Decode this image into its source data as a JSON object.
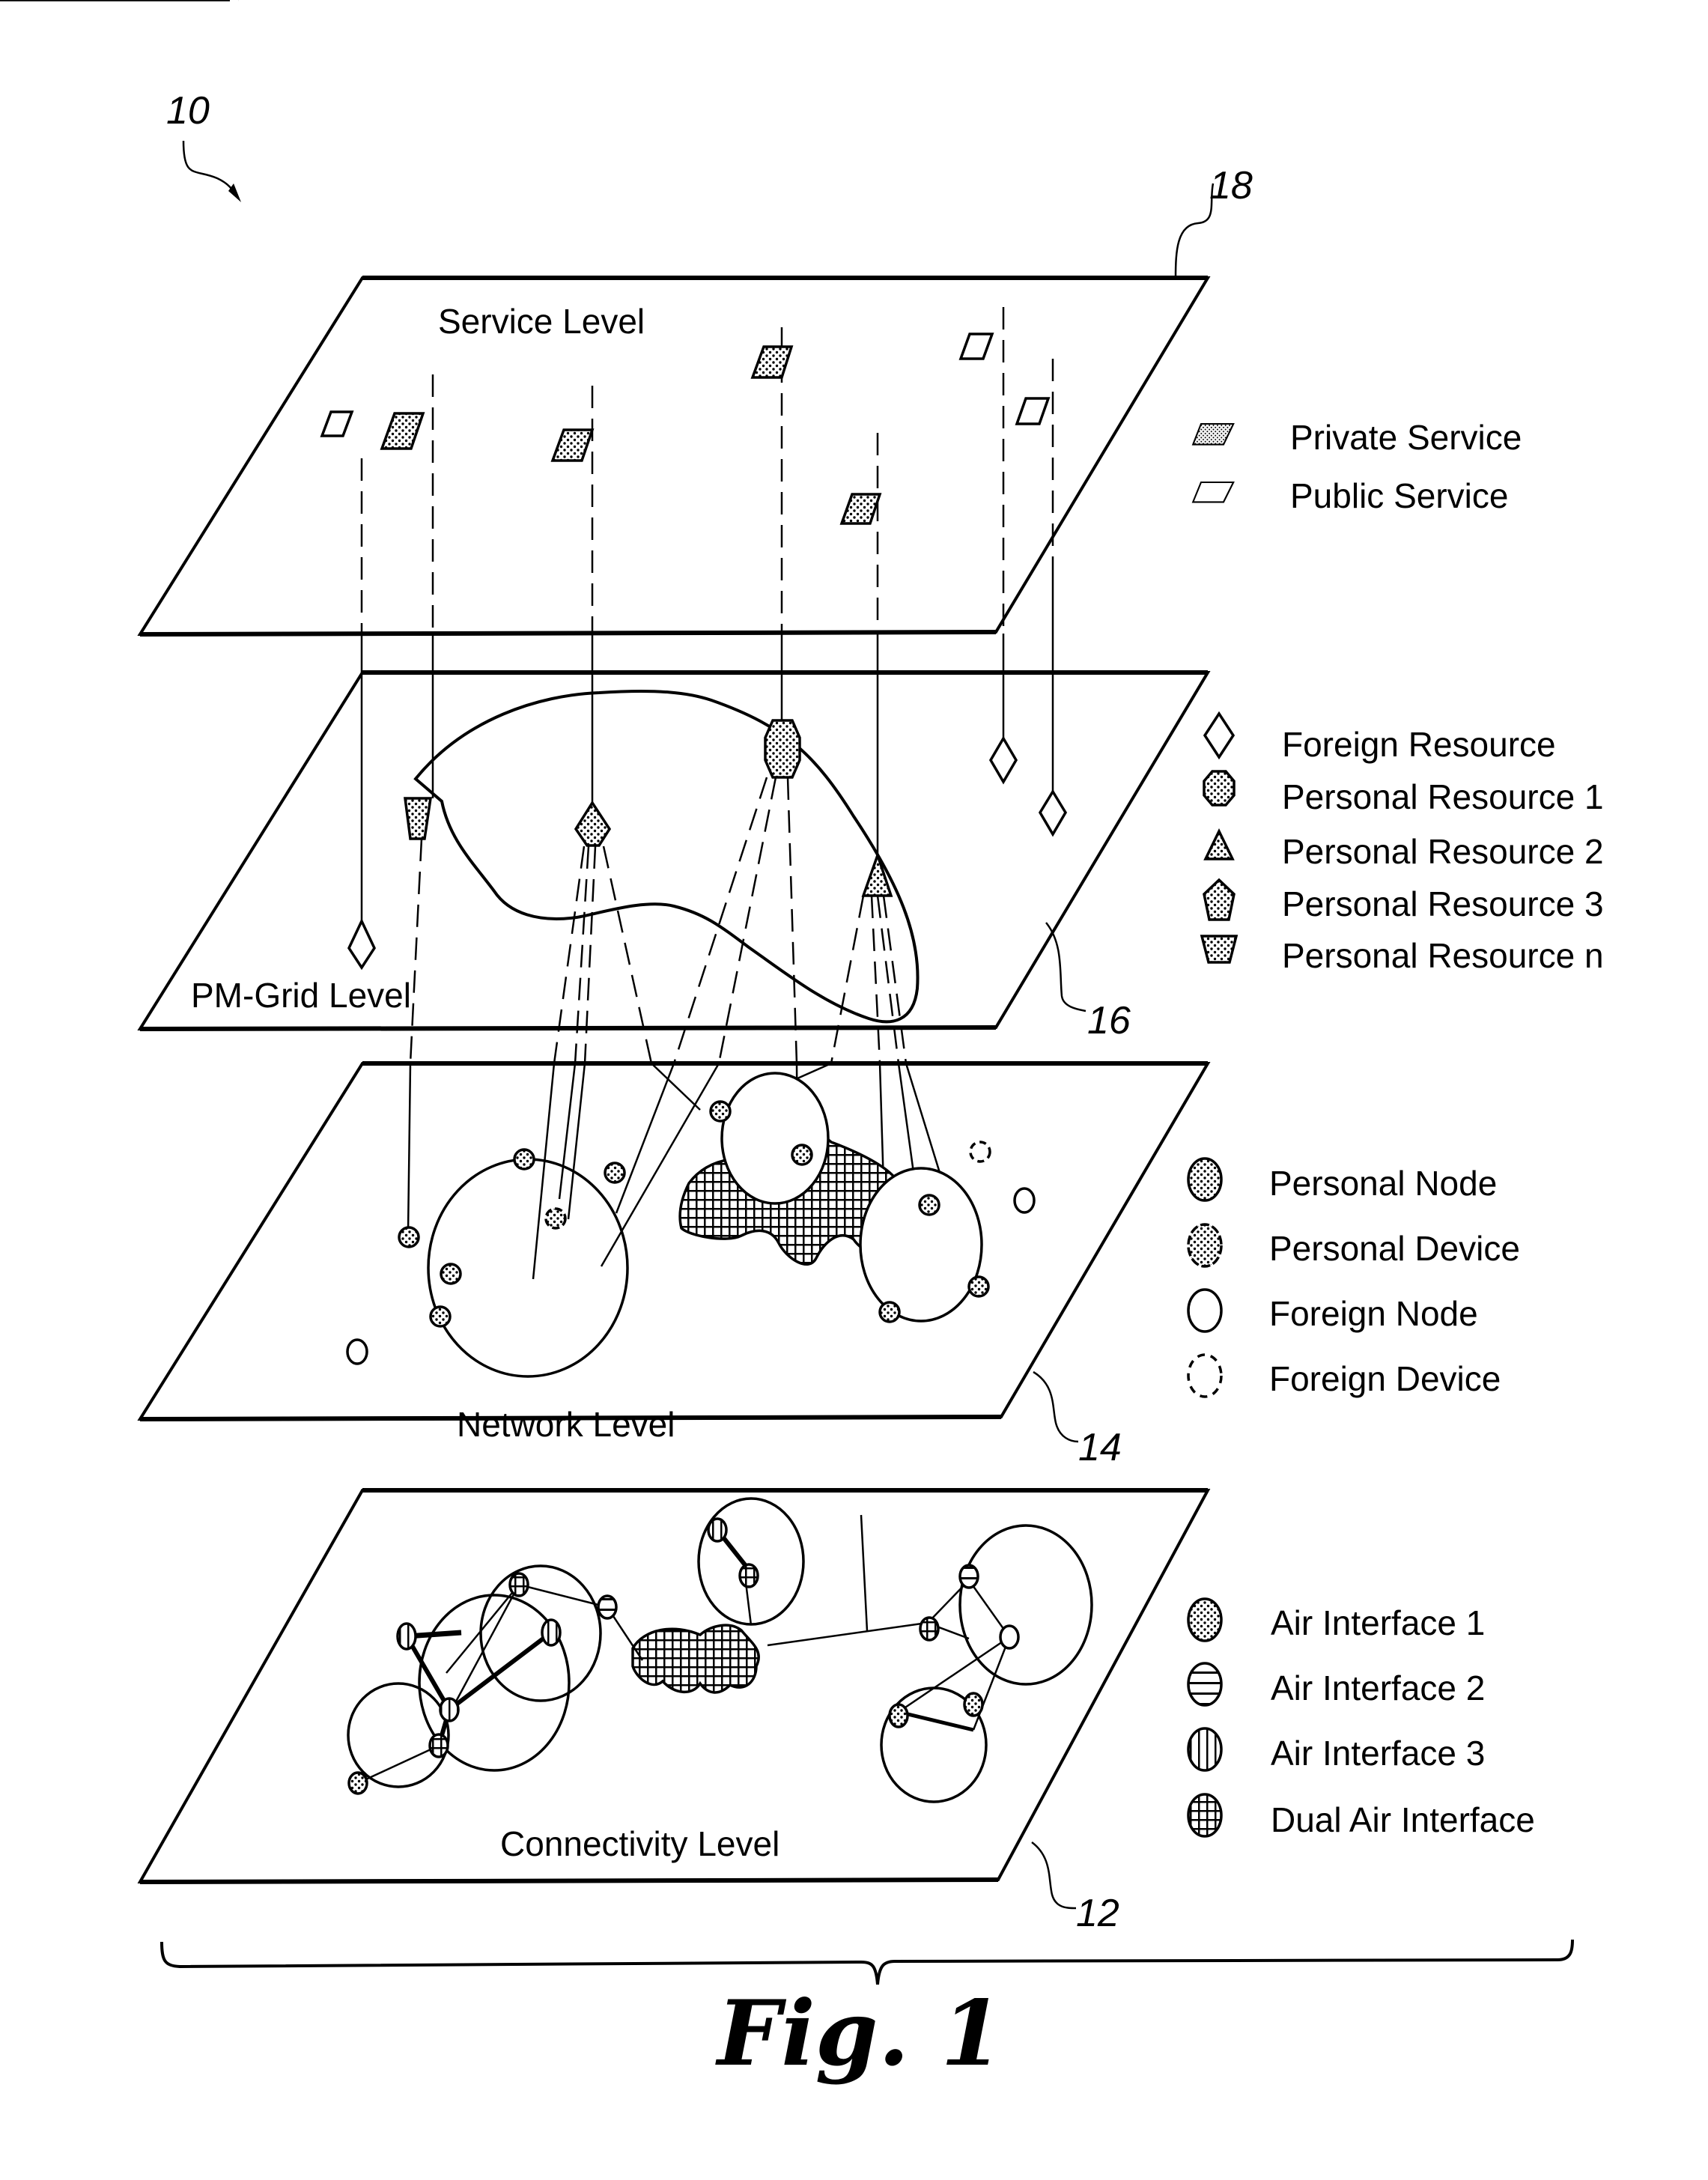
{
  "figure": {
    "caption": "Fig. 1",
    "system_ref": "10"
  },
  "levels": [
    {
      "id": "service",
      "label": "Service Level",
      "ref": "18"
    },
    {
      "id": "pmgrid",
      "label": "PM-Grid Level",
      "ref": "16"
    },
    {
      "id": "network",
      "label": "Network Level",
      "ref": "14"
    },
    {
      "id": "connectivity",
      "label": "Connectivity Level",
      "ref": "12"
    }
  ],
  "legends": {
    "service": [
      {
        "symbol": "private-service",
        "label": "Private Service"
      },
      {
        "symbol": "public-service",
        "label": "Public Service"
      }
    ],
    "pmgrid": [
      {
        "symbol": "foreign-resource",
        "label": "Foreign Resource"
      },
      {
        "symbol": "personal-resource-1",
        "label": "Personal Resource 1"
      },
      {
        "symbol": "personal-resource-2",
        "label": "Personal Resource 2"
      },
      {
        "symbol": "personal-resource-3",
        "label": "Personal Resource 3"
      },
      {
        "symbol": "personal-resource-n",
        "label": "Personal Resource n"
      }
    ],
    "network": [
      {
        "symbol": "personal-node",
        "label": "Personal Node"
      },
      {
        "symbol": "personal-device",
        "label": "Personal Device"
      },
      {
        "symbol": "foreign-node",
        "label": "Foreign Node"
      },
      {
        "symbol": "foreign-device",
        "label": "Foreign Device"
      }
    ],
    "connectivity": [
      {
        "symbol": "air-interface-1",
        "label": "Air Interface 1"
      },
      {
        "symbol": "air-interface-2",
        "label": "Air Interface 2"
      },
      {
        "symbol": "air-interface-3",
        "label": "Air Interface 3"
      },
      {
        "symbol": "dual-air-interface",
        "label": "Dual Air Interface"
      }
    ]
  },
  "colors": {
    "ink": "#000000",
    "paper": "#ffffff",
    "shade": "#bdbdbd"
  }
}
